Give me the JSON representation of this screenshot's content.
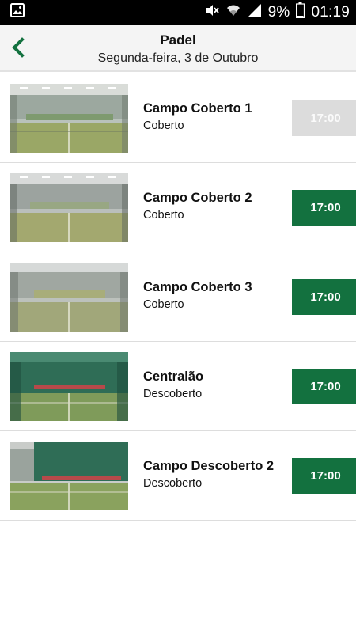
{
  "status_bar": {
    "battery_percent": "9%",
    "time": "01:19"
  },
  "header": {
    "title": "Padel",
    "subtitle": "Segunda-feira, 3 de Outubro"
  },
  "courts": [
    {
      "name": "Campo Coberto 1",
      "type": "Coberto",
      "time": "17:00",
      "available": false
    },
    {
      "name": "Campo Coberto 2",
      "type": "Coberto",
      "time": "17:00",
      "available": true
    },
    {
      "name": "Campo Coberto 3",
      "type": "Coberto",
      "time": "17:00",
      "available": true
    },
    {
      "name": "Centralão",
      "type": "Descoberto",
      "time": "17:00",
      "available": true
    },
    {
      "name": "Campo Descoberto 2",
      "type": "Descoberto",
      "time": "17:00",
      "available": true
    }
  ],
  "colors": {
    "accent": "#13713f",
    "disabled": "#dcdcdc"
  }
}
